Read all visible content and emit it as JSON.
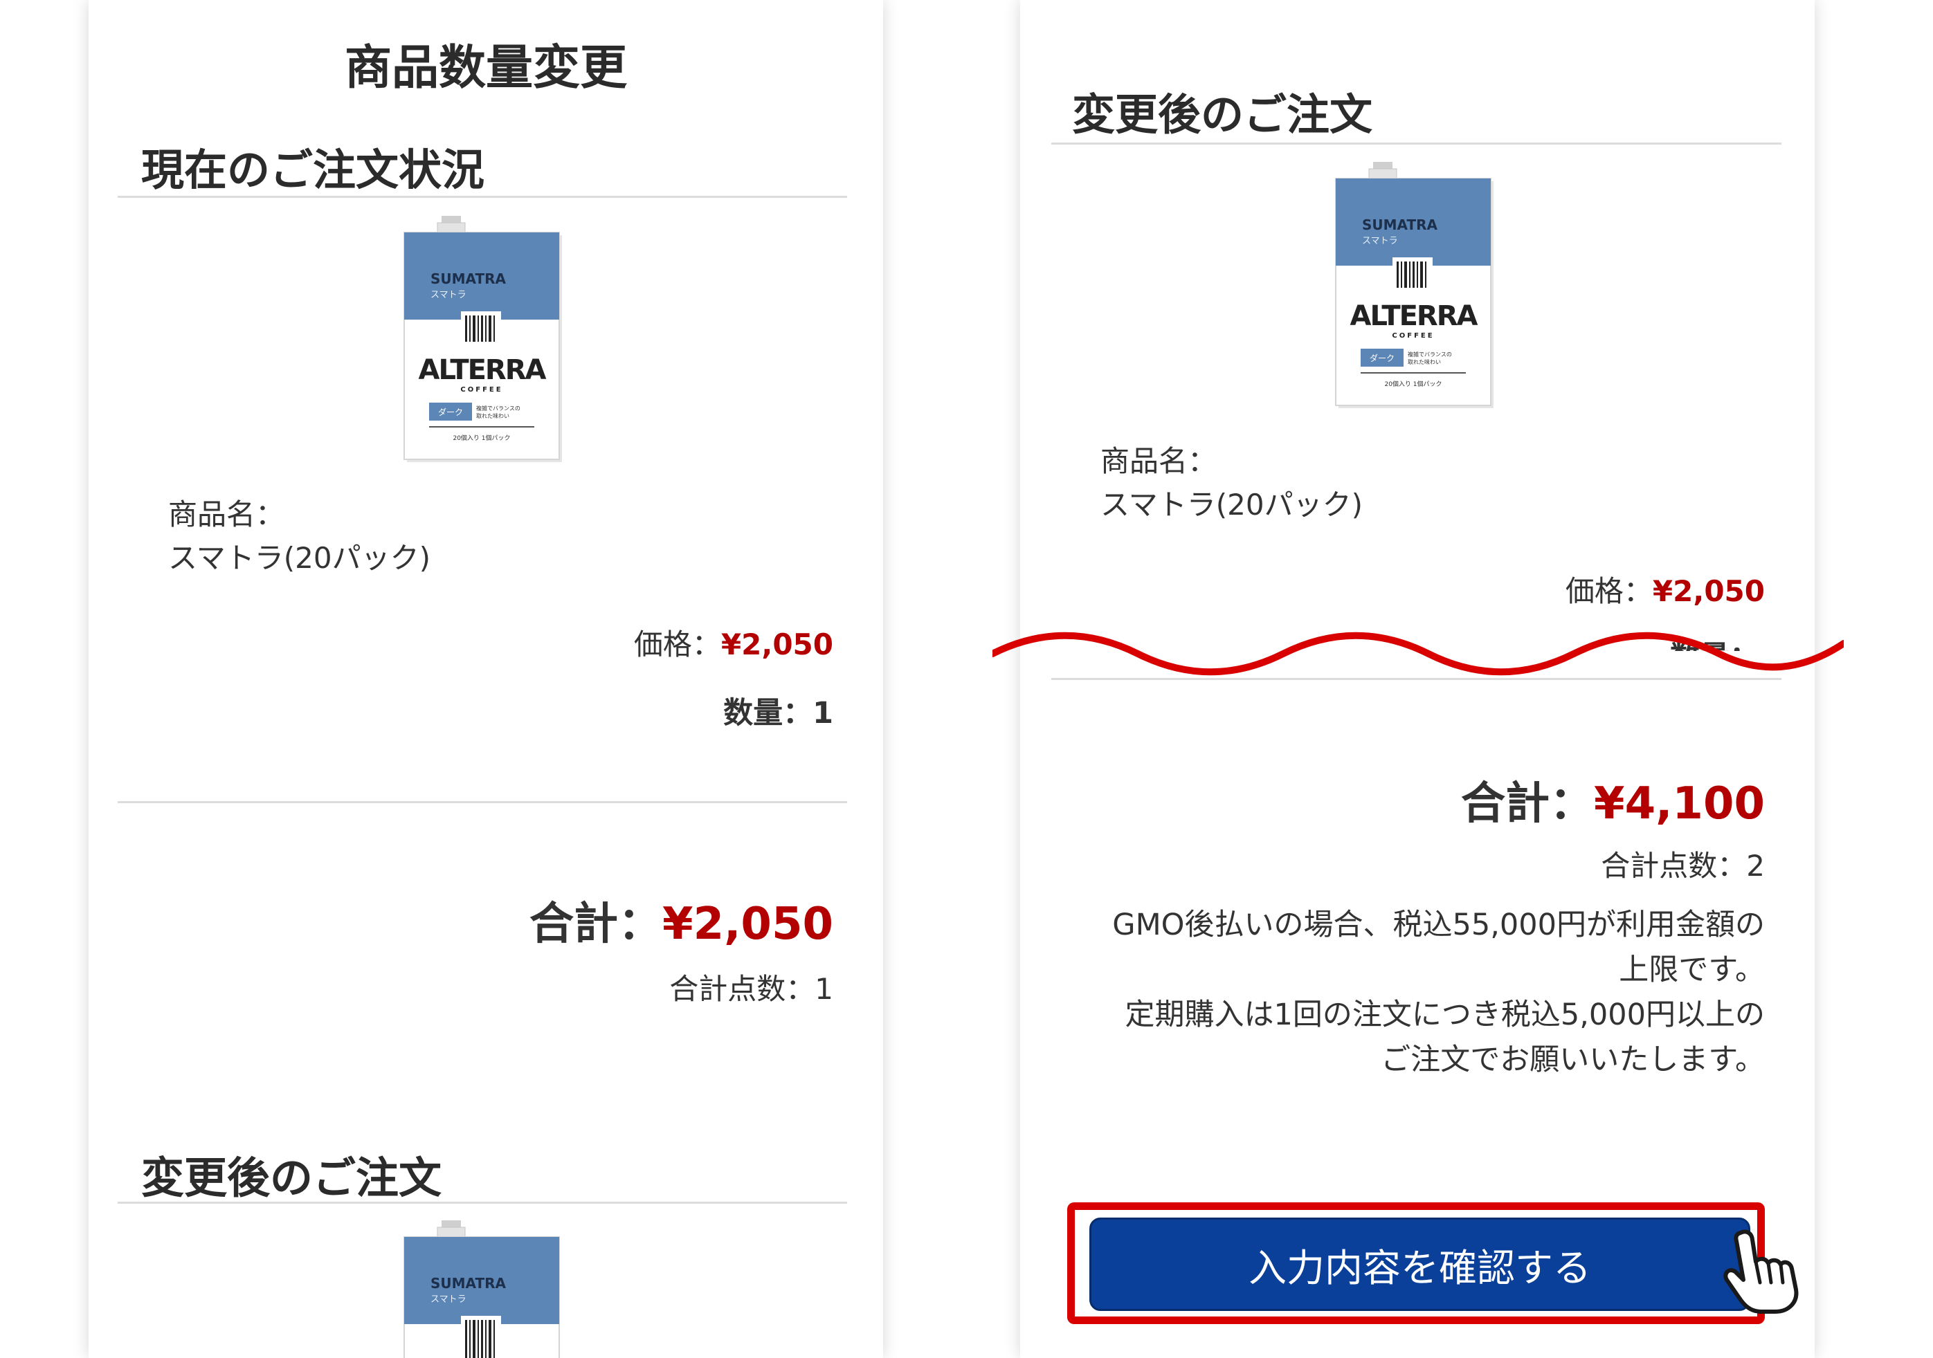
{
  "left_panel": {
    "page_title": "商品数量変更",
    "current_section_title": "現在のご注文状況",
    "product": {
      "name_label": "商品名：",
      "name": "スマトラ(20パック)",
      "price_label": "価格：",
      "price": "¥2,050",
      "quantity": "数量：1"
    },
    "total_label": "合計：",
    "total_value": "¥2,050",
    "total_count": "合計点数：1",
    "after_section_title": "変更後のご注文"
  },
  "right_panel": {
    "after_section_title": "変更後のご注文",
    "product": {
      "name_label": "商品名：",
      "name": "スマトラ(20パック)",
      "price_label": "価格：",
      "price": "¥2,050",
      "quantity_cut": "数量："
    },
    "total_label": "合計：",
    "total_value": "¥4,100",
    "total_count": "合計点数：2",
    "notice_lines": [
      "GMO後払いの場合、税込55,000円が利用金額の",
      "上限です。",
      "定期購入は1回の注文につき税込5,000円以上の",
      "ご注文でお願いいたします。"
    ],
    "confirm_button": "入力内容を確認する"
  },
  "package": {
    "origin": "SUMATRA",
    "origin_kana": "スマトラ",
    "brand": "ALTERRA",
    "sub": "COFFEE",
    "roast": "ダーク",
    "note1": "複雑でバランスの",
    "note2": "取れた味わい",
    "footer": "20個入り 1個パック"
  },
  "colors": {
    "accent_red": "#b30000",
    "button_blue": "#0a4099",
    "annotation_red": "#d90000",
    "package_blue": "#5b86b6"
  },
  "icons": [
    "wave-cut-marker",
    "hand-pointer-icon"
  ]
}
